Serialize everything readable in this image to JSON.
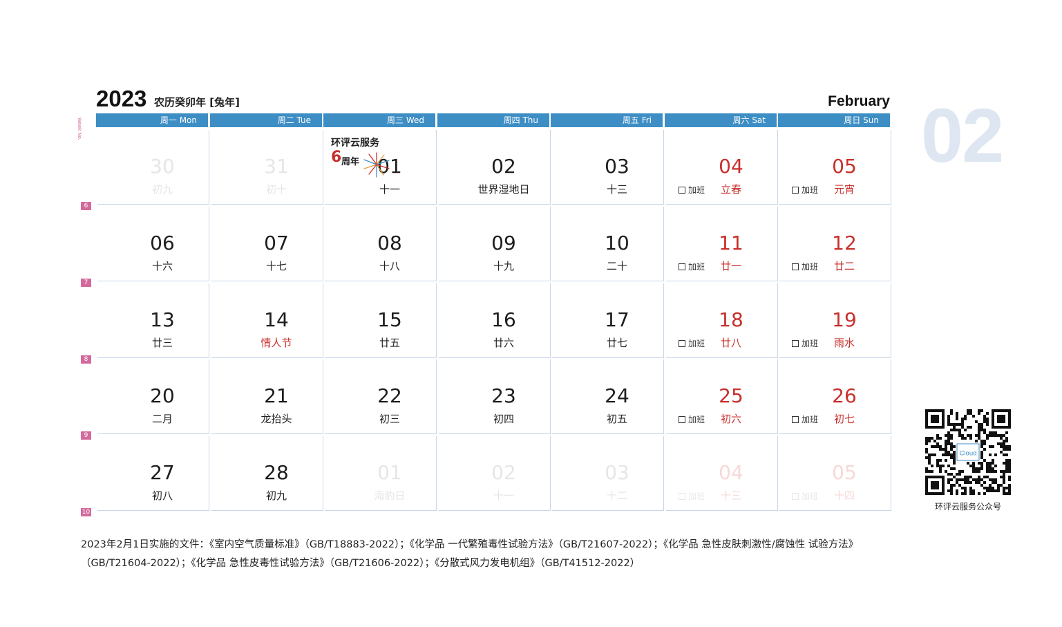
{
  "header": {
    "year": "2023",
    "lunar_year": "农历癸卯年 [兔年]",
    "month_en": "February",
    "month_num": "02",
    "week_no_label": "Week No."
  },
  "weekdays": [
    "周一  Mon",
    "周二  Tue",
    "周三  Wed",
    "周四  Thu",
    "周五  Fri",
    "周六  Sat",
    "周日  Sun"
  ],
  "overtime_label": "加班",
  "weeks": [
    {
      "no": "6",
      "days": [
        {
          "n": "30",
          "s": "初九",
          "faded": true
        },
        {
          "n": "31",
          "s": "初十",
          "faded": true
        },
        {
          "n": "01",
          "s": "十一"
        },
        {
          "n": "02",
          "s": "世界湿地日"
        },
        {
          "n": "03",
          "s": "十三"
        },
        {
          "n": "04",
          "s": "立春"
        },
        {
          "n": "05",
          "s": "元宵"
        }
      ]
    },
    {
      "no": "7",
      "days": [
        {
          "n": "06",
          "s": "十六"
        },
        {
          "n": "07",
          "s": "十七"
        },
        {
          "n": "08",
          "s": "十八"
        },
        {
          "n": "09",
          "s": "十九"
        },
        {
          "n": "10",
          "s": "二十"
        },
        {
          "n": "11",
          "s": "廿一"
        },
        {
          "n": "12",
          "s": "廿二"
        }
      ]
    },
    {
      "no": "8",
      "days": [
        {
          "n": "13",
          "s": "廿三"
        },
        {
          "n": "14",
          "s": "情人节",
          "red": true
        },
        {
          "n": "15",
          "s": "廿五"
        },
        {
          "n": "16",
          "s": "廿六"
        },
        {
          "n": "17",
          "s": "廿七"
        },
        {
          "n": "18",
          "s": "廿八"
        },
        {
          "n": "19",
          "s": "雨水"
        }
      ]
    },
    {
      "no": "9",
      "days": [
        {
          "n": "20",
          "s": "二月"
        },
        {
          "n": "21",
          "s": "龙抬头"
        },
        {
          "n": "22",
          "s": "初三"
        },
        {
          "n": "23",
          "s": "初四"
        },
        {
          "n": "24",
          "s": "初五"
        },
        {
          "n": "25",
          "s": "初六"
        },
        {
          "n": "26",
          "s": "初七"
        }
      ]
    },
    {
      "no": "10",
      "days": [
        {
          "n": "27",
          "s": "初八"
        },
        {
          "n": "28",
          "s": "初九"
        },
        {
          "n": "01",
          "s": "海豹日",
          "faded": true
        },
        {
          "n": "02",
          "s": "十一",
          "faded": true
        },
        {
          "n": "03",
          "s": "十二",
          "faded": true
        },
        {
          "n": "04",
          "s": "十三",
          "faded": true
        },
        {
          "n": "05",
          "s": "十四",
          "faded": true
        }
      ]
    }
  ],
  "promo": {
    "title": "环评云服务",
    "number": "6",
    "anniversary": "周年"
  },
  "footer_text": "2023年2月1日实施的文件：《室内空气质量标准》（GB/T18883-2022）；《化学品 一代繁殖毒性试验方法》（GB/T21607-2022）；《化学品 急性皮肤刺激性/腐蚀性 试验方法》（GB/T21604-2022）；《化学品 急性皮毒性试验方法》（GB/T21606-2022）；《分散式风力发电机组》（GB/T41512-2022）",
  "qr": {
    "caption": "环评云服务公众号",
    "logo_text": "Cloud"
  },
  "colors": {
    "weekday_bar": "#3d8ec4",
    "weekend_red": "#c9302c",
    "week_badge": "#d36a9b",
    "big_month": "#dde6f1"
  }
}
